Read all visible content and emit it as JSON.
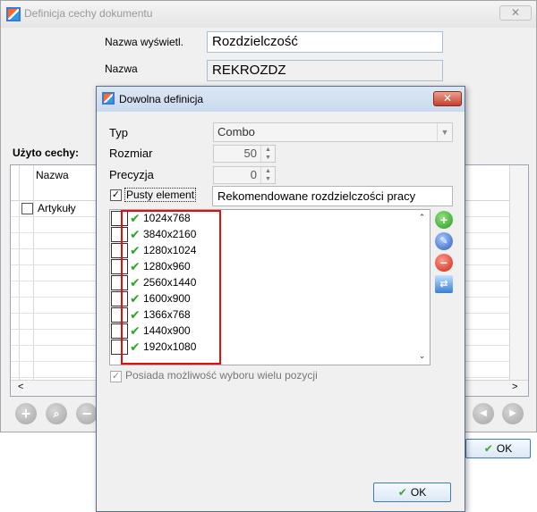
{
  "back_window": {
    "title": "Definicja cechy dokumentu",
    "close_label": "✕",
    "display_name_label": "Nazwa wyświetl.",
    "display_name_value": "Rozdzielczość",
    "name_label": "Nazwa",
    "name_value": "REKROZDZ",
    "used_features_label": "Użyto cechy:",
    "grid_header_name": "Nazwa",
    "grid_first_row": "Artykuły",
    "scroll_left": "<",
    "scroll_right": ">",
    "ok_label": "OK"
  },
  "dialog": {
    "title": "Dowolna definicja",
    "close_label": "✕",
    "type_label": "Typ",
    "type_value": "Combo",
    "size_label": "Rozmiar",
    "size_value": "50",
    "precision_label": "Precyzja",
    "precision_value": "0",
    "empty_element_label": "Pusty element",
    "empty_element_checked": true,
    "empty_element_value": "Rekomendowane rozdzielczości pracy",
    "items": [
      {
        "label": "1024x768"
      },
      {
        "label": "3840x2160"
      },
      {
        "label": "1280x1024"
      },
      {
        "label": "1280x960"
      },
      {
        "label": "2560x1440"
      },
      {
        "label": "1600x900"
      },
      {
        "label": "1366x768"
      },
      {
        "label": "1440x900"
      },
      {
        "label": "1920x1080"
      }
    ],
    "multi_select_label": "Posiada możliwość wyboru wielu pozycji",
    "multi_select_checked": true,
    "ok_label": "OK"
  }
}
